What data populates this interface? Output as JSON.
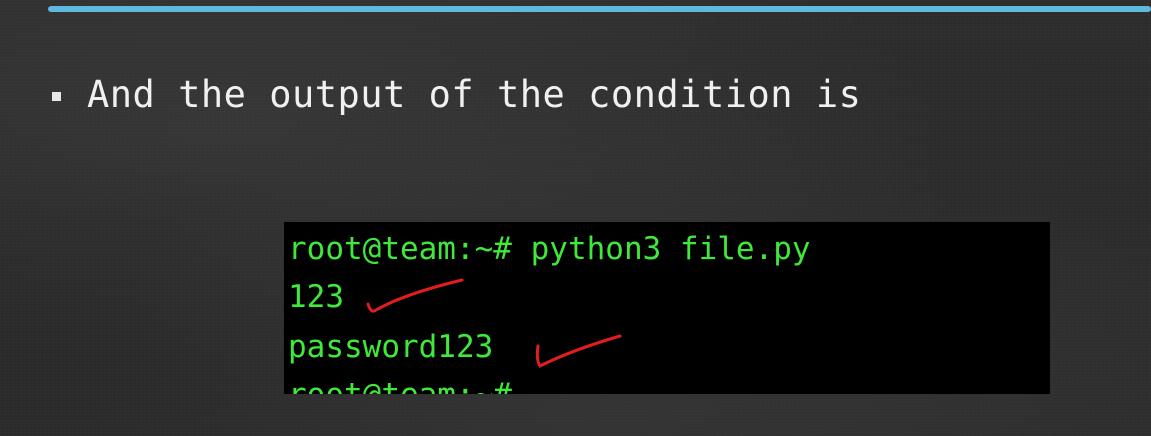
{
  "slide": {
    "bullet_text": "And the output of the condition is",
    "accent_color": "#5fb8dd"
  },
  "terminal": {
    "text_color": "#3ee93a",
    "background": "#000000",
    "lines": [
      "root@team:~# python3 file.py",
      "123",
      "password123",
      "root@team:~#"
    ]
  },
  "annotations": [
    {
      "icon": "checkmark-icon",
      "color": "#e01e1e"
    },
    {
      "icon": "checkmark-icon",
      "color": "#e01e1e"
    }
  ]
}
